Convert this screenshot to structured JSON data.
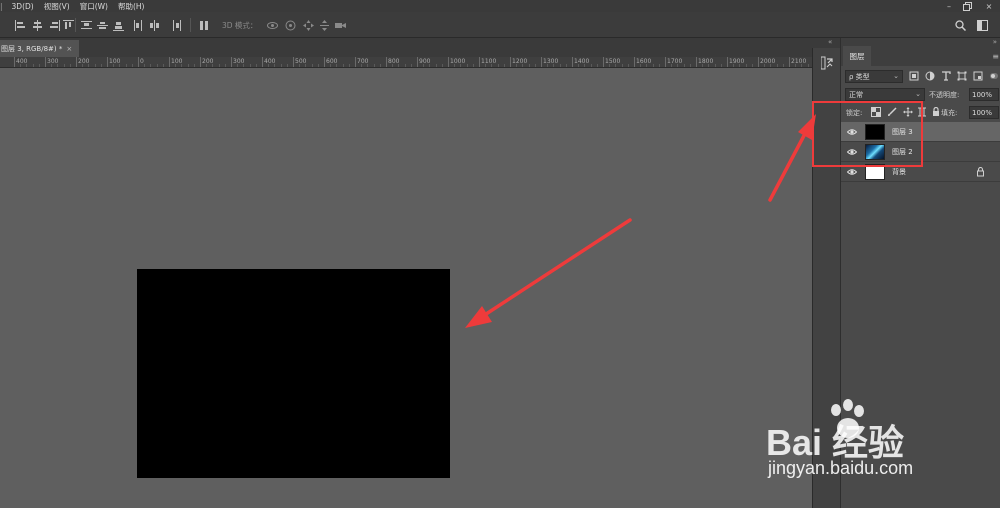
{
  "menubar": {
    "items": [
      "3D(D)",
      "视图(V)",
      "窗口(W)",
      "帮助(H)"
    ]
  },
  "options_bar": {
    "mode_3d_label": "3D 模式："
  },
  "document_tab": {
    "title": "图层 3, RGB/8#) *",
    "close": "×"
  },
  "ruler": {
    "labels": [
      "400",
      "300",
      "200",
      "100",
      "0",
      "100",
      "200",
      "300",
      "400",
      "500",
      "600",
      "700",
      "800",
      "900",
      "1000",
      "1100",
      "1200",
      "1300",
      "1400",
      "1500",
      "1600",
      "1700",
      "1800",
      "1900",
      "2000",
      "2100"
    ]
  },
  "layers_panel": {
    "tab_label": "图层",
    "menu_icon": "≡",
    "filter": {
      "label": "ρ 类型",
      "chevron": "⌄"
    },
    "blend_mode": {
      "value": "正常",
      "chevron": "⌄"
    },
    "opacity": {
      "label": "不透明度:",
      "value": "100%"
    },
    "lock": {
      "label": "锁定:"
    },
    "fill": {
      "label": "填充:",
      "value": "100%"
    },
    "layers": [
      {
        "name": "图层 3",
        "selected": true,
        "thumb": "black"
      },
      {
        "name": "图层 2",
        "selected": false,
        "thumb": "image"
      },
      {
        "name": "背景",
        "selected": false,
        "thumb": "white",
        "locked": true
      }
    ]
  },
  "canvas": {
    "layer_color": "#000000",
    "background_color": "#5f5f5f"
  },
  "annotation": {
    "color": "#ee3b3b"
  },
  "watermark": {
    "brand": "Bai   经验",
    "url": "jingyan.baidu.com"
  }
}
